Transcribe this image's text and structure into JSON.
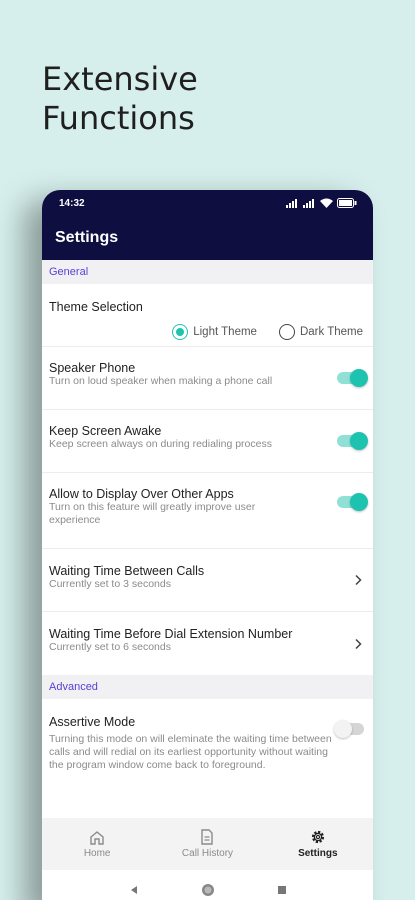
{
  "promo": {
    "line1": "Extensive",
    "line2": "Functions"
  },
  "status_bar": {
    "time": "14:32"
  },
  "app_bar": {
    "title": "Settings"
  },
  "general": {
    "header": "General",
    "theme": {
      "title": "Theme Selection",
      "options": [
        {
          "label": "Light Theme",
          "selected": true
        },
        {
          "label": "Dark Theme",
          "selected": false
        }
      ]
    },
    "speaker": {
      "title": "Speaker Phone",
      "subtitle": "Turn on loud speaker when making a phone call",
      "enabled": true
    },
    "awake": {
      "title": "Keep Screen Awake",
      "subtitle": "Keep screen always on during redialing process",
      "enabled": true
    },
    "overlay": {
      "title": "Allow to Display Over Other Apps",
      "subtitle": "Turn on this feature will greatly improve user experience",
      "enabled": true
    },
    "wait_calls": {
      "title": "Waiting Time Between Calls",
      "subtitle": "Currently set to 3 seconds"
    },
    "wait_ext": {
      "title": "Waiting Time Before Dial Extension Number",
      "subtitle": "Currently set to 6 seconds"
    }
  },
  "advanced": {
    "header": "Advanced",
    "assertive": {
      "title": "Assertive Mode",
      "subtitle": "Turning this mode on will eleminate the waiting time between calls and will redial on its earliest opportunity without waiting the program window come back to foreground.",
      "enabled": false
    }
  },
  "bottom_nav": {
    "items": [
      {
        "label": "Home",
        "icon": "home-icon",
        "active": false
      },
      {
        "label": "Call History",
        "icon": "document-icon",
        "active": false
      },
      {
        "label": "Settings",
        "icon": "gear-icon",
        "active": true
      }
    ]
  },
  "colors": {
    "accent": "#1ec3b0",
    "app_bar": "#0e0e40",
    "section_text": "#5a3fd6",
    "background": "#d6efec"
  }
}
